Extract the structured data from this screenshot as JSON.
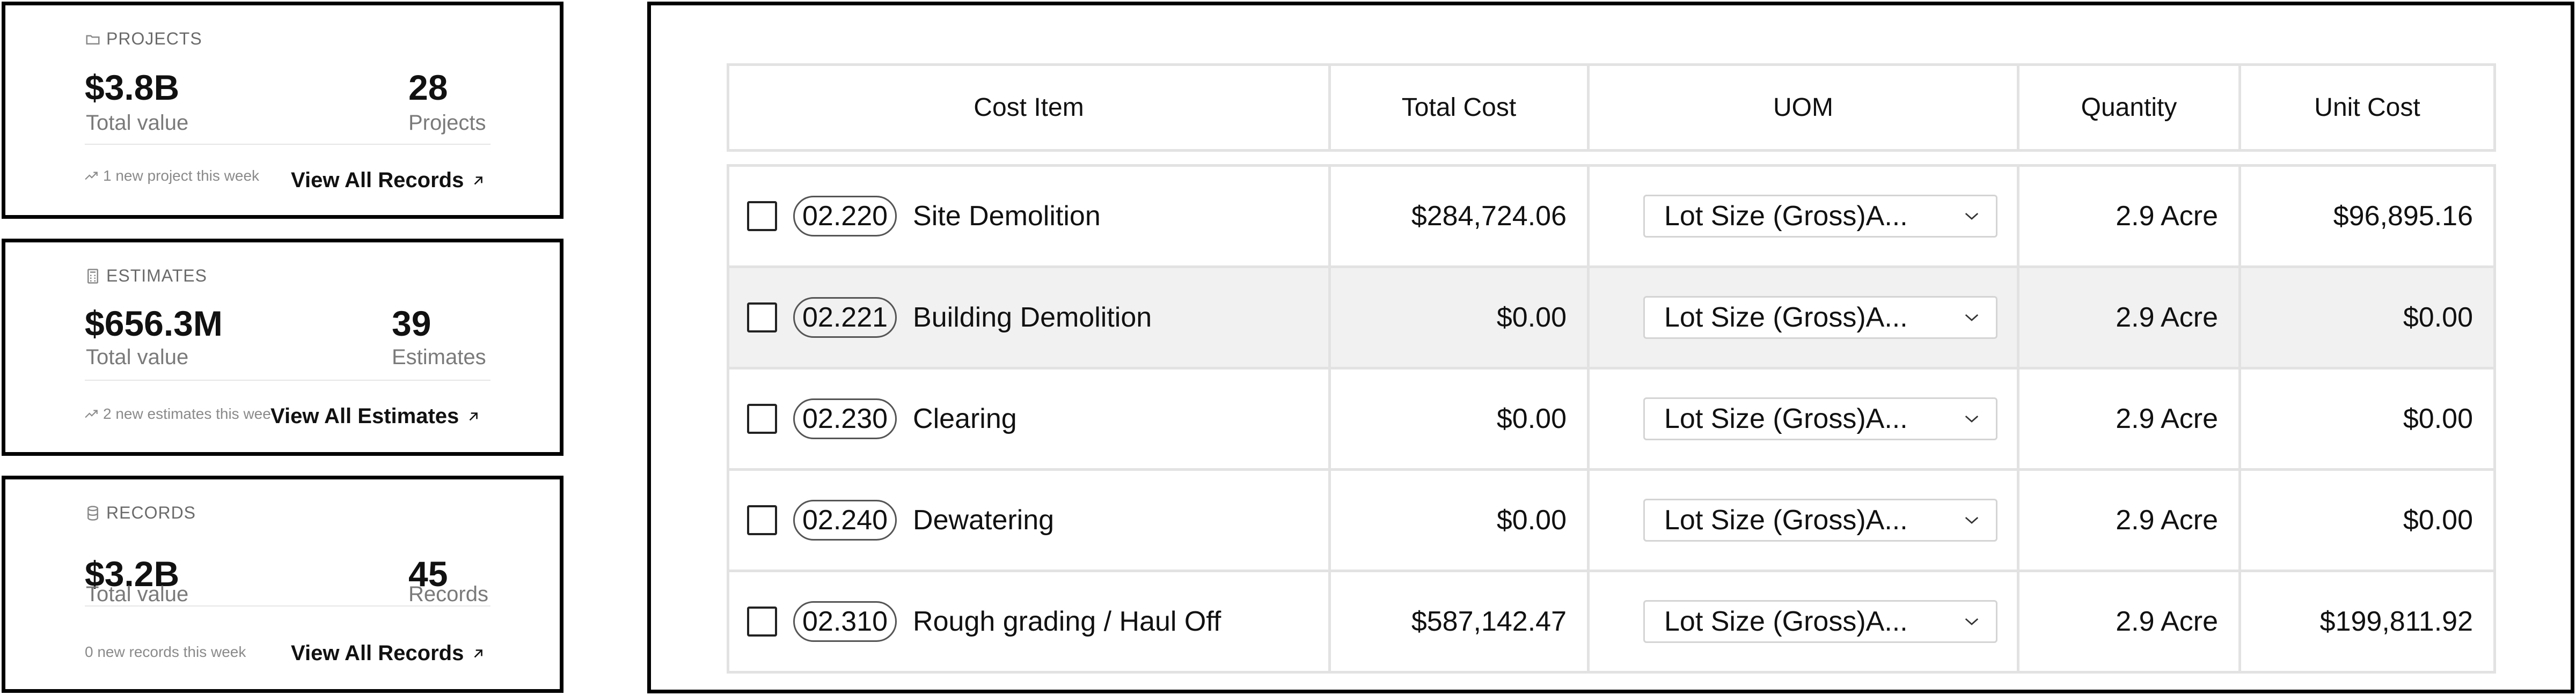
{
  "cards": [
    {
      "section_label": "PROJECTS",
      "icon": "folder-icon",
      "primary_value": "$3.8B",
      "primary_label": "Total value",
      "secondary_value": "28",
      "secondary_label": "Projects",
      "trend_text": "1 new project this week",
      "link_label": "View All Records"
    },
    {
      "section_label": "ESTIMATES",
      "icon": "calculator-icon",
      "primary_value": "$656.3M",
      "primary_label": "Total value",
      "secondary_value": "39",
      "secondary_label": "Estimates",
      "trend_text": "2 new estimates this week",
      "link_label": "View All Estimates"
    },
    {
      "section_label": "RECORDS",
      "icon": "database-icon",
      "primary_value": "$3.2B",
      "primary_label": "Total value",
      "secondary_value": "45",
      "secondary_label": "Records",
      "trend_text": "0 new records this week",
      "link_label": "View All Records"
    }
  ],
  "table": {
    "headers": [
      "Cost Item",
      "Total Cost",
      "UOM",
      "Quantity",
      "Unit Cost"
    ],
    "rows": [
      {
        "code": "02.220",
        "name": "Site Demolition",
        "total_cost": "$284,724.06",
        "uom": "Lot Size (Gross)A...",
        "quantity": "2.9 Acre",
        "unit_cost": "$96,895.16"
      },
      {
        "code": "02.221",
        "name": "Building Demolition",
        "total_cost": "$0.00",
        "uom": "Lot Size (Gross)A...",
        "quantity": "2.9 Acre",
        "unit_cost": "$0.00"
      },
      {
        "code": "02.230",
        "name": "Clearing",
        "total_cost": "$0.00",
        "uom": "Lot Size (Gross)A...",
        "quantity": "2.9 Acre",
        "unit_cost": "$0.00"
      },
      {
        "code": "02.240",
        "name": "Dewatering",
        "total_cost": "$0.00",
        "uom": "Lot Size (Gross)A...",
        "quantity": "2.9 Acre",
        "unit_cost": "$0.00"
      },
      {
        "code": "02.310",
        "name": "Rough grading / Haul Off",
        "total_cost": "$587,142.47",
        "uom": "Lot Size (Gross)A...",
        "quantity": "2.9 Acre",
        "unit_cost": "$199,811.92"
      }
    ]
  }
}
